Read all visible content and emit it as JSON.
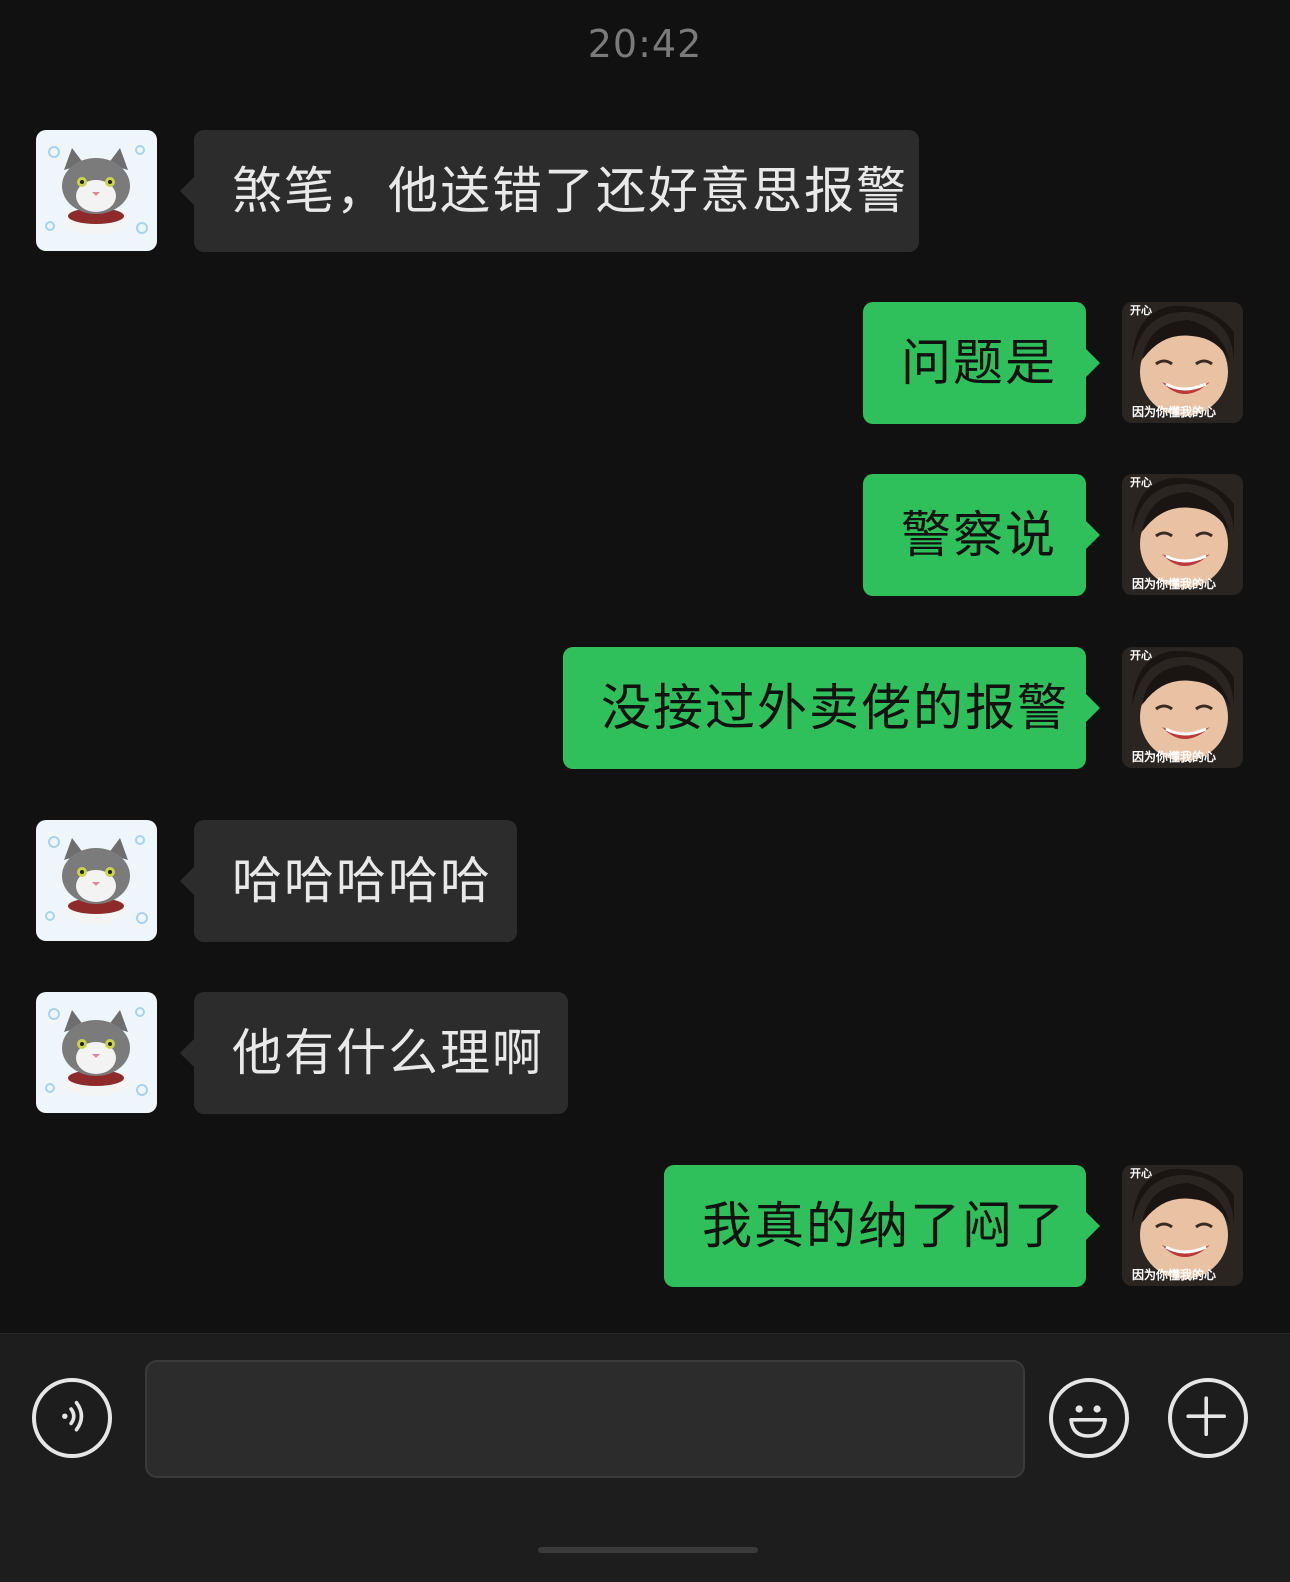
{
  "chat": {
    "timestamp": "20:42",
    "messages": [
      {
        "side": "in",
        "text": "煞笔，他送错了还好意思报警"
      },
      {
        "side": "out",
        "text": "问题是"
      },
      {
        "side": "out",
        "text": "警察说"
      },
      {
        "side": "out",
        "text": "没接过外卖佬的报警"
      },
      {
        "side": "in",
        "text": "哈哈哈哈哈"
      },
      {
        "side": "in",
        "text": "他有什么理啊"
      },
      {
        "side": "out",
        "text": "我真的纳了闷了"
      }
    ]
  },
  "avatars": {
    "contact": {
      "icon": "cat-avatar-icon"
    },
    "self": {
      "icon": "laughing-face-sticker-avatar",
      "caption_top": "开心",
      "caption_bottom": "因为你懂我的心"
    }
  },
  "input_bar": {
    "voice_icon": "voice-icon",
    "text_value": "",
    "emoji_icon": "emoji-icon",
    "plus_icon": "plus-icon"
  },
  "colors": {
    "background": "#111111",
    "incoming_bubble": "#2c2c2c",
    "outgoing_bubble": "#2fc05b",
    "timestamp": "#7a7a7a"
  }
}
